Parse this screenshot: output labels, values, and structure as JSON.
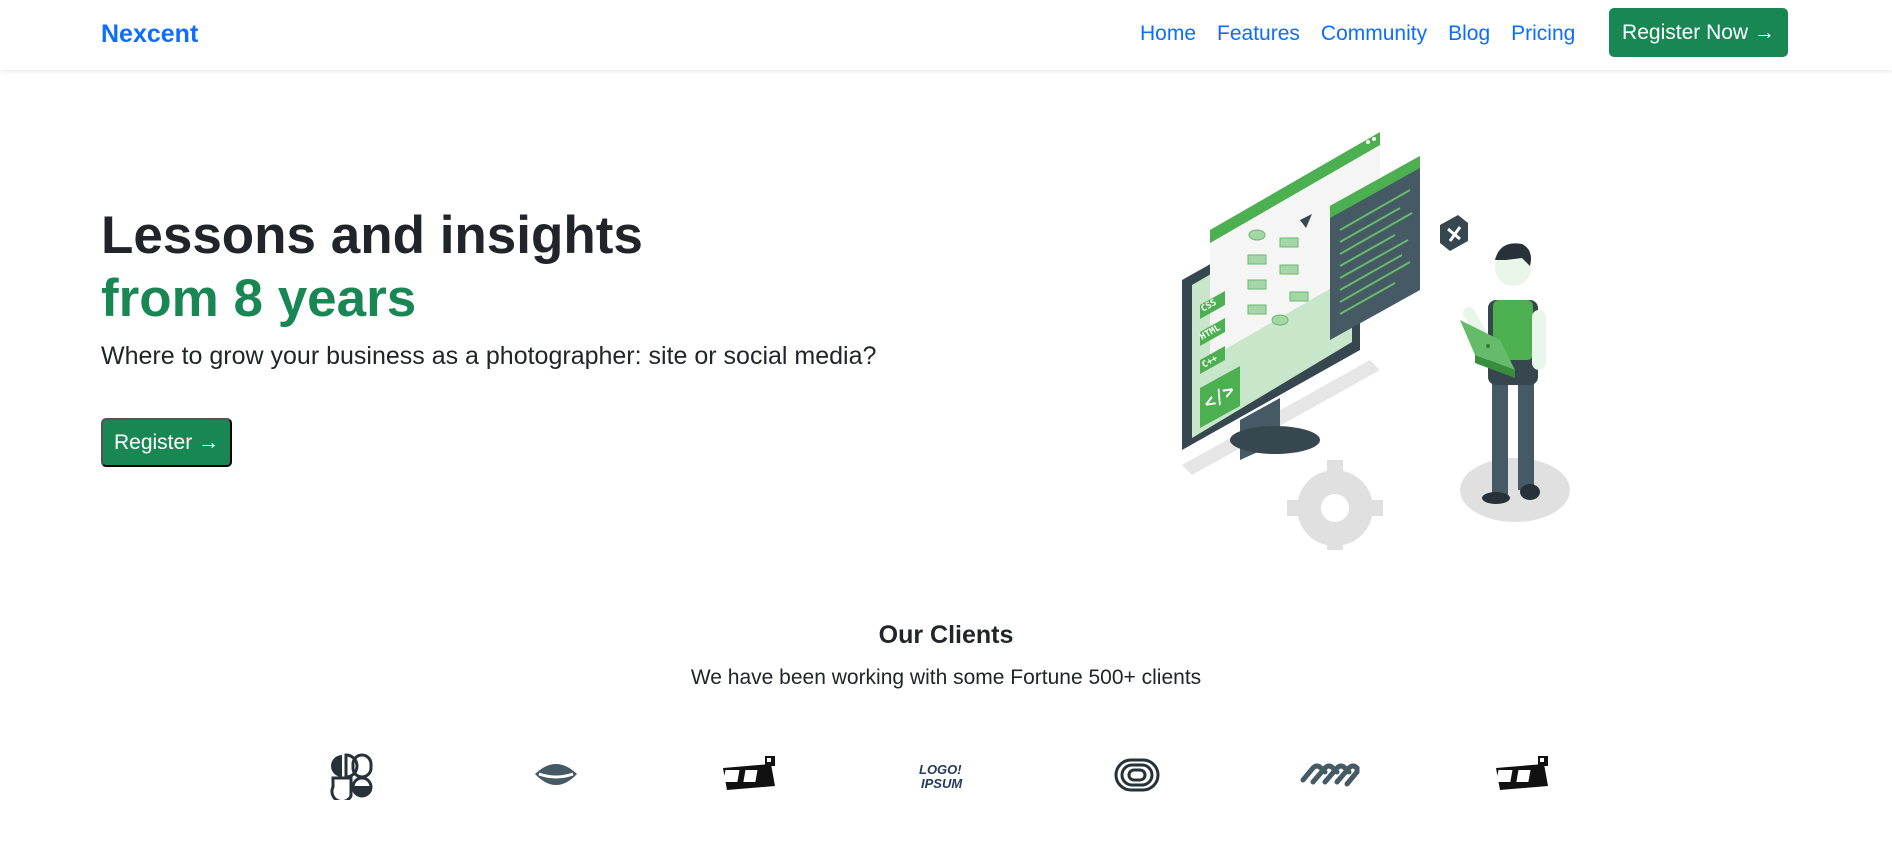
{
  "nav": {
    "brand": "Nexcent",
    "links": [
      "Home",
      "Features",
      "Community",
      "Blog",
      "Pricing"
    ],
    "cta": "Register Now →"
  },
  "hero": {
    "title_line1": "Lessons and insights",
    "title_line2": "from 8 years",
    "subtitle": "Where to grow your business as a photographer: site or social media?",
    "button": "Register →",
    "illustration_icon": "developer-at-monitor-illustration",
    "code_tags": [
      "CSS",
      "HTML",
      "C++"
    ]
  },
  "clients": {
    "title": "Our Clients",
    "subtitle": "We have been working with some Fortune 500+ clients",
    "logos": [
      "logo-shapes",
      "logo-lips",
      "logo-box",
      "logo-ipsum",
      "logo-rings",
      "logo-chain",
      "logo-box"
    ],
    "logo_ipsum_text": "LOGO IPSUM"
  },
  "colors": {
    "brand_blue": "#0d6efd",
    "accent_green": "#198754",
    "illustration_green": "#4caf50",
    "dark_slate": "#37474f"
  }
}
